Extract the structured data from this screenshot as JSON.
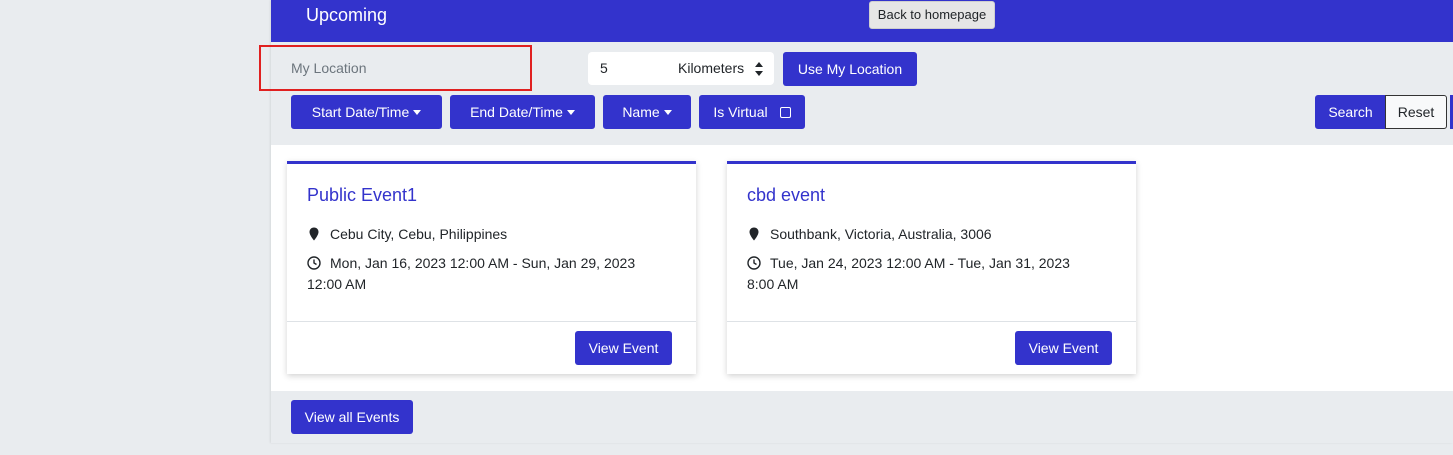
{
  "header": {
    "title": "Upcoming",
    "back_label": "Back to homepage"
  },
  "filters": {
    "location_placeholder": "My Location",
    "distance_value": "5",
    "distance_unit": "Kilometers",
    "use_location_label": "Use My Location",
    "dropdowns": [
      {
        "label": "Start Date/Time"
      },
      {
        "label": "End Date/Time"
      },
      {
        "label": "Name"
      }
    ],
    "virtual_label": "Is Virtual",
    "search_label": "Search",
    "reset_label": "Reset"
  },
  "events": [
    {
      "title": "Public Event1",
      "location": "Cebu City, Cebu, Philippines",
      "datetime_line1": "Mon, Jan 16, 2023 12:00 AM - Sun, Jan 29, 2023",
      "datetime_line2": "12:00 AM",
      "button_label": "View Event"
    },
    {
      "title": "cbd event",
      "location": "Southbank, Victoria, Australia, 3006",
      "datetime_line1": "Tue, Jan 24, 2023 12:00 AM - Tue, Jan 31, 2023",
      "datetime_line2": "8:00 AM",
      "button_label": "View Event"
    }
  ],
  "footer": {
    "view_all_label": "View all Events"
  },
  "colors": {
    "primary": "#3333cc",
    "highlight": "#e02020"
  },
  "icons": [
    "map-pin-icon",
    "clock-icon",
    "caret-down-icon",
    "sort-arrows-icon",
    "checkbox-icon"
  ]
}
